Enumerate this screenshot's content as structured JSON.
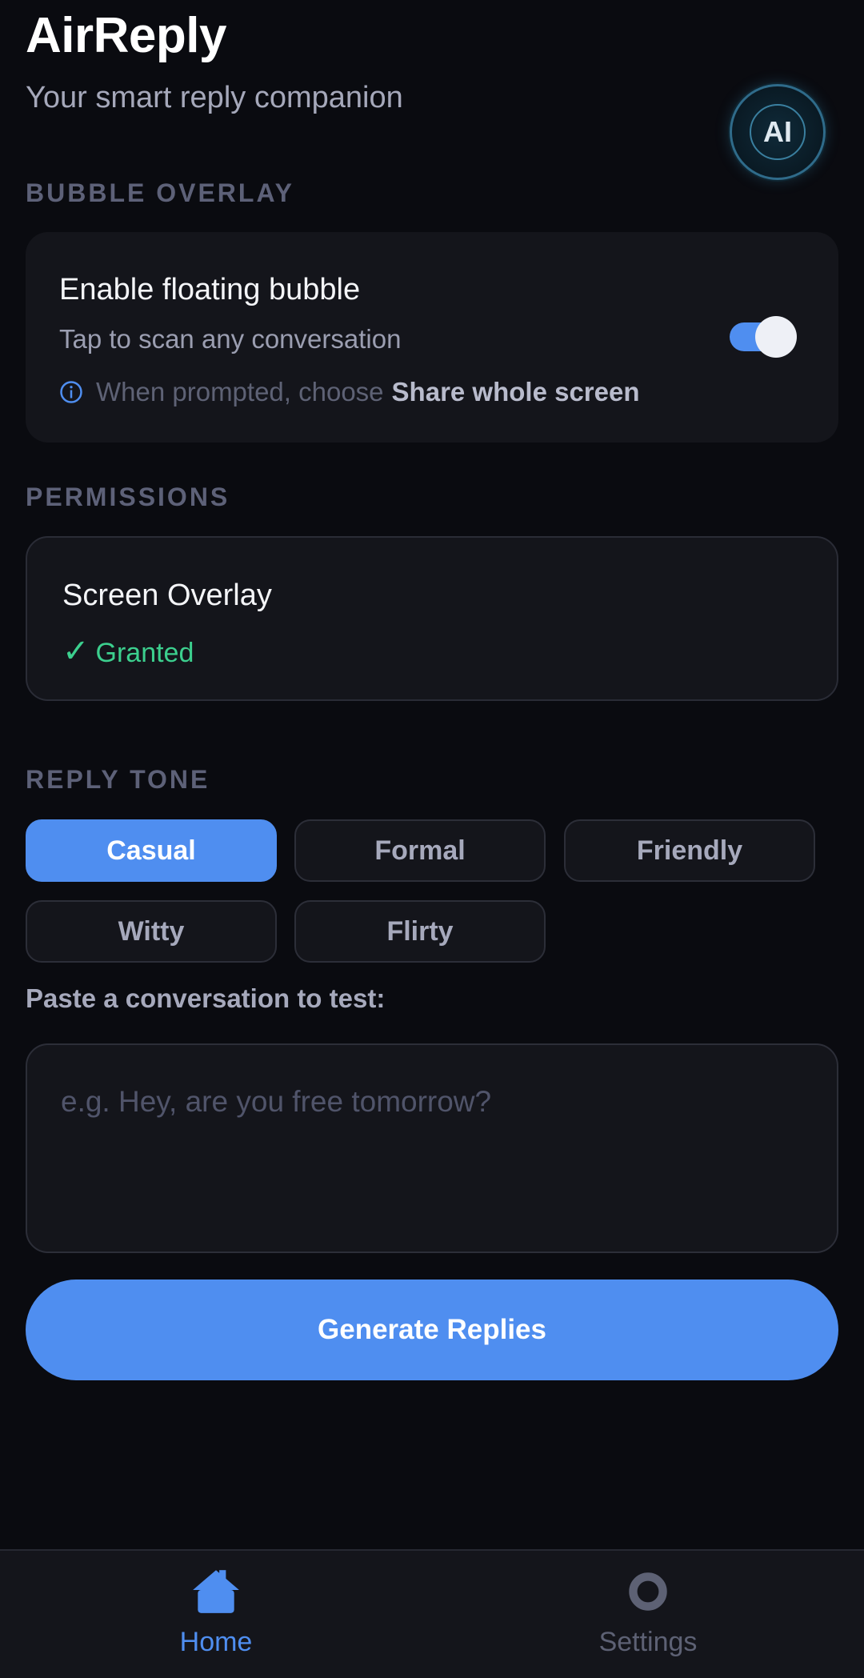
{
  "header": {
    "title": "AirReply",
    "subtitle": "Your smart reply companion",
    "badge_text": "AI"
  },
  "bubble_overlay": {
    "section_label": "BUBBLE OVERLAY",
    "title": "Enable floating bubble",
    "subtitle": "Tap to scan any conversation",
    "hint_prefix": "When prompted, choose",
    "hint_strong": "Share whole screen",
    "toggle_on": true
  },
  "permissions": {
    "section_label": "PERMISSIONS",
    "title": "Screen Overlay",
    "status_check": "✓",
    "status_text": "Granted"
  },
  "reply_tone": {
    "section_label": "REPLY TONE",
    "options": [
      "Casual",
      "Formal",
      "Friendly",
      "Witty",
      "Flirty"
    ],
    "selected": "Casual"
  },
  "test": {
    "label": "Paste a conversation to test:",
    "placeholder": "e.g. Hey, are you free tomorrow?",
    "value": ""
  },
  "generate_label": "Generate Replies",
  "nav": {
    "home": "Home",
    "settings": "Settings",
    "active": "home"
  },
  "colors": {
    "background": "#0a0b10",
    "card": "#14151b",
    "accent": "#4f8ef0",
    "success": "#3ccf8e",
    "muted": "#5d6178"
  }
}
